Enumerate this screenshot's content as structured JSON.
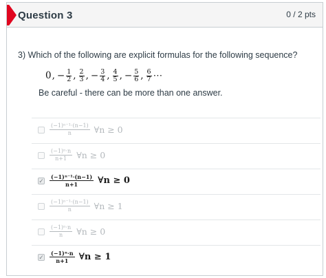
{
  "question": {
    "title": "Question 3",
    "points": "0 / 2 pts",
    "prompt": "3) Which of the following are explicit formulas for the following sequence?",
    "note": "Be careful - there can be more than one answer."
  },
  "sequence": [
    {
      "sign": "",
      "value": "0",
      "sep": ","
    },
    {
      "sign": "−",
      "num": "1",
      "den": "2",
      "sep": ","
    },
    {
      "sign": "",
      "num": "2",
      "den": "3",
      "sep": ","
    },
    {
      "sign": "−",
      "num": "3",
      "den": "4",
      "sep": ","
    },
    {
      "sign": "",
      "num": "4",
      "den": "5",
      "sep": ","
    },
    {
      "sign": "−",
      "num": "5",
      "den": "6",
      "sep": ","
    },
    {
      "sign": "",
      "num": "6",
      "den": "7",
      "sep": "⋯"
    }
  ],
  "answers": [
    {
      "numerator": "(−1)ⁿ⁻¹·(n−1)",
      "denominator": "n",
      "condition": "∀n ≥ 0",
      "selected": false
    },
    {
      "numerator": "(−1)ⁿ·n",
      "denominator": "n+1",
      "condition": "∀n ≥ 0",
      "selected": false
    },
    {
      "numerator": "(−1)ⁿ⁻¹·(n−1)",
      "denominator": "n+1",
      "condition": "∀n ≥ 0",
      "selected": true
    },
    {
      "numerator": "(−1)ⁿ⁻¹·(n−1)",
      "denominator": "n",
      "condition": "∀n ≥ 1",
      "selected": false
    },
    {
      "numerator": "(−1)ⁿ·n",
      "denominator": "n",
      "condition": "∀n ≥ 0",
      "selected": false
    },
    {
      "numerator": "(−1)ⁿ·n",
      "denominator": "n+1",
      "condition": "∀n ≥ 1",
      "selected": true
    }
  ],
  "icons": {
    "check": "check-icon",
    "flag": "flag-icon"
  },
  "colors": {
    "flag": "#e0061f",
    "header_bg": "#f5f5f5",
    "muted_answer": "#b3b8bc",
    "selected_answer": "#1a1a1a"
  }
}
